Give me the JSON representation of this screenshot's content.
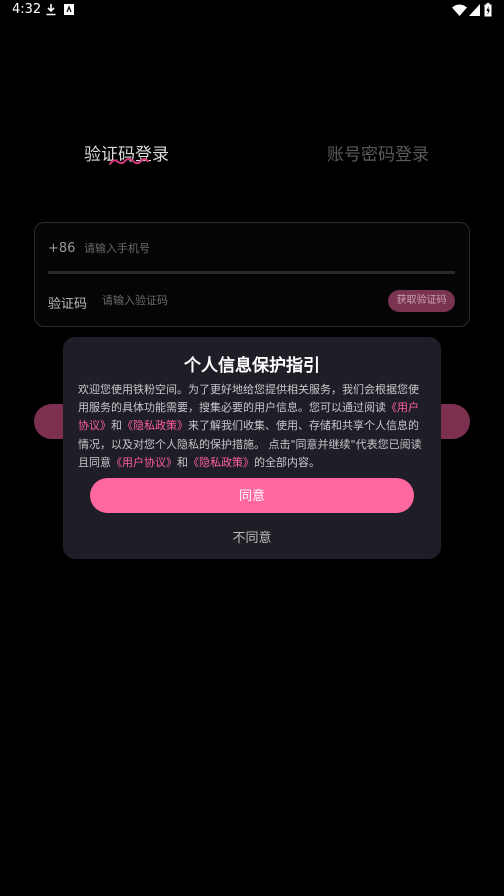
{
  "status_bar": {
    "time": "4:32",
    "icons": [
      "download-icon",
      "app-notification-icon",
      "wifi-icon",
      "signal-icon",
      "battery-icon"
    ]
  },
  "tabs": [
    {
      "label": "验证码登录",
      "active": true
    },
    {
      "label": "账号密码登录",
      "active": false
    }
  ],
  "login_form": {
    "country_code": "+86",
    "phone_placeholder": "请输入手机号",
    "code_label": "验证码",
    "code_placeholder": "请输入验证码",
    "get_code_label": "获取验证码"
  },
  "dialog": {
    "title": "个人信息保护指引",
    "body_1": "欢迎您使用铁粉空间。为了更好地给您提供相关服务，我们会根据您使用服务的具体功能需要，搜集必要的用户信息。您可以通过阅读",
    "link_user_agreement": "《用户协议》",
    "and_1": "和",
    "link_privacy_policy": "《隐私政策》",
    "body_2": "来了解我们收集、使用、存储和共享个人信息的情况，以及对您个人隐私的保护措施。 点击\"同意并继续\"代表您已阅读且同意",
    "link_user_agreement_2": "《用户协议》",
    "and_2": "和",
    "link_privacy_policy_2": "《隐私政策》",
    "body_3": "的全部内容。",
    "agree_label": "同意",
    "disagree_label": "不同意"
  },
  "colors": {
    "accent": "#ff679f",
    "link": "#ff5f9a",
    "dialog_bg": "#1f1e26",
    "background": "#000000"
  }
}
